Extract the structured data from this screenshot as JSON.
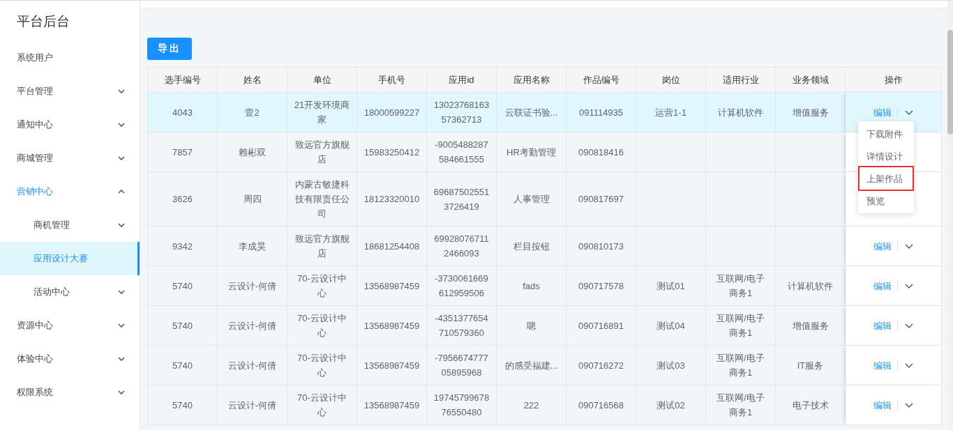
{
  "sidebar": {
    "title": "平台后台",
    "items": [
      {
        "label": "系统用户",
        "kind": "leaf",
        "selected": false
      },
      {
        "label": "平台管理",
        "kind": "group",
        "expanded": false,
        "selected": false
      },
      {
        "label": "通知中心",
        "kind": "group",
        "expanded": false,
        "selected": false
      },
      {
        "label": "商城管理",
        "kind": "group",
        "expanded": false,
        "selected": false
      },
      {
        "label": "营销中心",
        "kind": "group",
        "expanded": true,
        "selected": false,
        "children": [
          {
            "label": "商机管理",
            "kind": "group",
            "expanded": false,
            "selected": false
          },
          {
            "label": "应用设计大赛",
            "kind": "leaf",
            "selected": true
          },
          {
            "label": "活动中心",
            "kind": "group",
            "expanded": false,
            "selected": false
          }
        ]
      },
      {
        "label": "资源中心",
        "kind": "group",
        "expanded": false,
        "selected": false
      },
      {
        "label": "体验中心",
        "kind": "group",
        "expanded": false,
        "selected": false
      },
      {
        "label": "权限系统",
        "kind": "group",
        "expanded": false,
        "selected": false
      }
    ]
  },
  "toolbar": {
    "export_button": "导出"
  },
  "table": {
    "columns": [
      "选手编号",
      "姓名",
      "单位",
      "手机号",
      "应用id",
      "应用名称",
      "作品编号",
      "岗位",
      "适用行业",
      "业务领域",
      "操作"
    ],
    "rows": [
      {
        "selected": true,
        "cells": [
          "4043",
          "壹2",
          "21开发环境商家",
          "18000599227",
          "1302376816357362713",
          "云联证书验...",
          "091114935",
          "运营1-1",
          "计算机软件",
          "增值服务"
        ],
        "edit": "编辑"
      },
      {
        "selected": false,
        "cells": [
          "7857",
          "赖彬双",
          "致远官方旗舰店",
          "15983250412",
          "-9005488287584661555",
          "HR考勤管理",
          "090818416",
          "",
          "",
          ""
        ]
      },
      {
        "selected": false,
        "cells": [
          "3626",
          "周四",
          "内蒙古敏捷科技有限责任公司",
          "18123320010",
          "696875025513726419",
          "人事管理",
          "090817697",
          "",
          "",
          ""
        ]
      },
      {
        "selected": false,
        "cells": [
          "9342",
          "李成昊",
          "致远官方旗舰店",
          "18681254408",
          "699280767112466093",
          "栏目按钮",
          "090810173",
          "",
          "",
          ""
        ],
        "edit": "编辑"
      },
      {
        "selected": false,
        "cells": [
          "5740",
          "云设计-何倩",
          "70-云设计中心",
          "13568987459",
          "-3730061669612959506",
          "fads",
          "090717578",
          "测试01",
          "互联网/电子商务1",
          "计算机软件"
        ],
        "edit": "编辑"
      },
      {
        "selected": false,
        "cells": [
          "5740",
          "云设计-何倩",
          "70-云设计中心",
          "13568987459",
          "-4351377654710579360",
          "嗯",
          "090716891",
          "测试04",
          "互联网/电子商务1",
          "增值服务"
        ],
        "edit": "编辑"
      },
      {
        "selected": false,
        "cells": [
          "5740",
          "云设计-何倩",
          "70-云设计中心",
          "13568987459",
          "-795667477705895968",
          "的感受福建...",
          "090716272",
          "测试03",
          "互联网/电子商务1",
          "IT服务"
        ],
        "edit": "编辑"
      },
      {
        "selected": false,
        "cells": [
          "5740",
          "云设计-何倩",
          "70-云设计中心",
          "13568987459",
          "1974579967876550480",
          "222",
          "090716568",
          "测试02",
          "互联网/电子商务1",
          "电子技术"
        ],
        "edit": "编辑"
      }
    ]
  },
  "dropdown": {
    "items": [
      {
        "label": "下载附件",
        "outlined": false
      },
      {
        "label": "详情设计",
        "outlined": false
      },
      {
        "label": "上架作品",
        "outlined": true
      },
      {
        "label": "预览",
        "outlined": false
      }
    ]
  }
}
